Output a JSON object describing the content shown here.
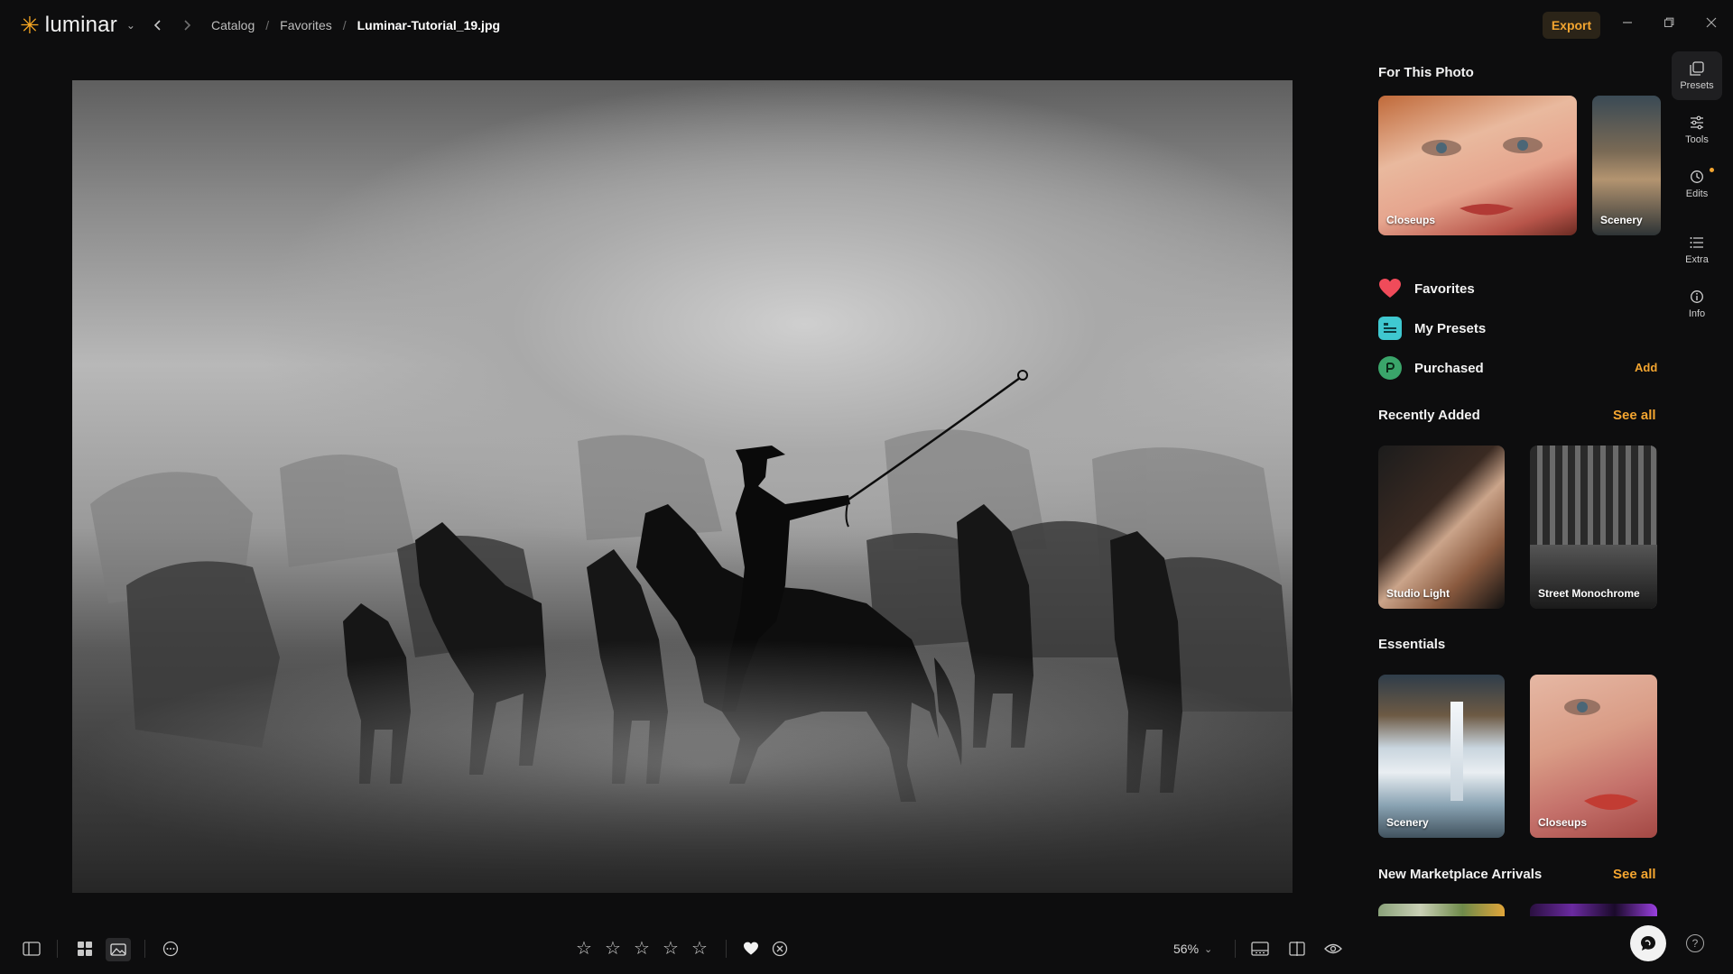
{
  "app": {
    "logo_text": "luminar",
    "logo_icon": "star-sun-icon"
  },
  "breadcrumb": [
    "Catalog",
    "Favorites",
    "Luminar-Tutorial_19.jpg"
  ],
  "toolbar": {
    "export_label": "Export"
  },
  "panel": {
    "for_this_photo": {
      "title": "For This Photo",
      "items": [
        {
          "label": "Closeups"
        },
        {
          "label": "Scenery"
        }
      ]
    },
    "lists": [
      {
        "label": "Favorites",
        "icon": "heart-icon",
        "color": "#f04b5a"
      },
      {
        "label": "My Presets",
        "icon": "presets-list-icon",
        "color": "#3fc8d0"
      },
      {
        "label": "Purchased",
        "icon": "purchased-icon",
        "color": "#3aa56a"
      }
    ],
    "add_label": "Add",
    "recently_added": {
      "title": "Recently Added",
      "see_all": "See all",
      "items": [
        {
          "label": "Studio Light"
        },
        {
          "label": "Street Monochrome"
        }
      ]
    },
    "essentials": {
      "title": "Essentials",
      "items": [
        {
          "label": "Scenery"
        },
        {
          "label": "Closeups"
        }
      ]
    },
    "marketplace": {
      "title": "New Marketplace Arrivals",
      "see_all": "See all"
    }
  },
  "rail": [
    {
      "label": "Presets",
      "icon": "presets-icon",
      "active": true
    },
    {
      "label": "Tools",
      "icon": "sliders-icon",
      "active": false
    },
    {
      "label": "Edits",
      "icon": "history-icon",
      "active": false
    },
    {
      "label": "Extra",
      "icon": "list-icon",
      "active": false
    },
    {
      "label": "Info",
      "icon": "info-icon",
      "active": false
    }
  ],
  "bottom": {
    "zoom": "56%",
    "rating": 0,
    "max_rating": 5
  },
  "colors": {
    "accent": "#f3a530",
    "background": "#0d0d0e"
  }
}
